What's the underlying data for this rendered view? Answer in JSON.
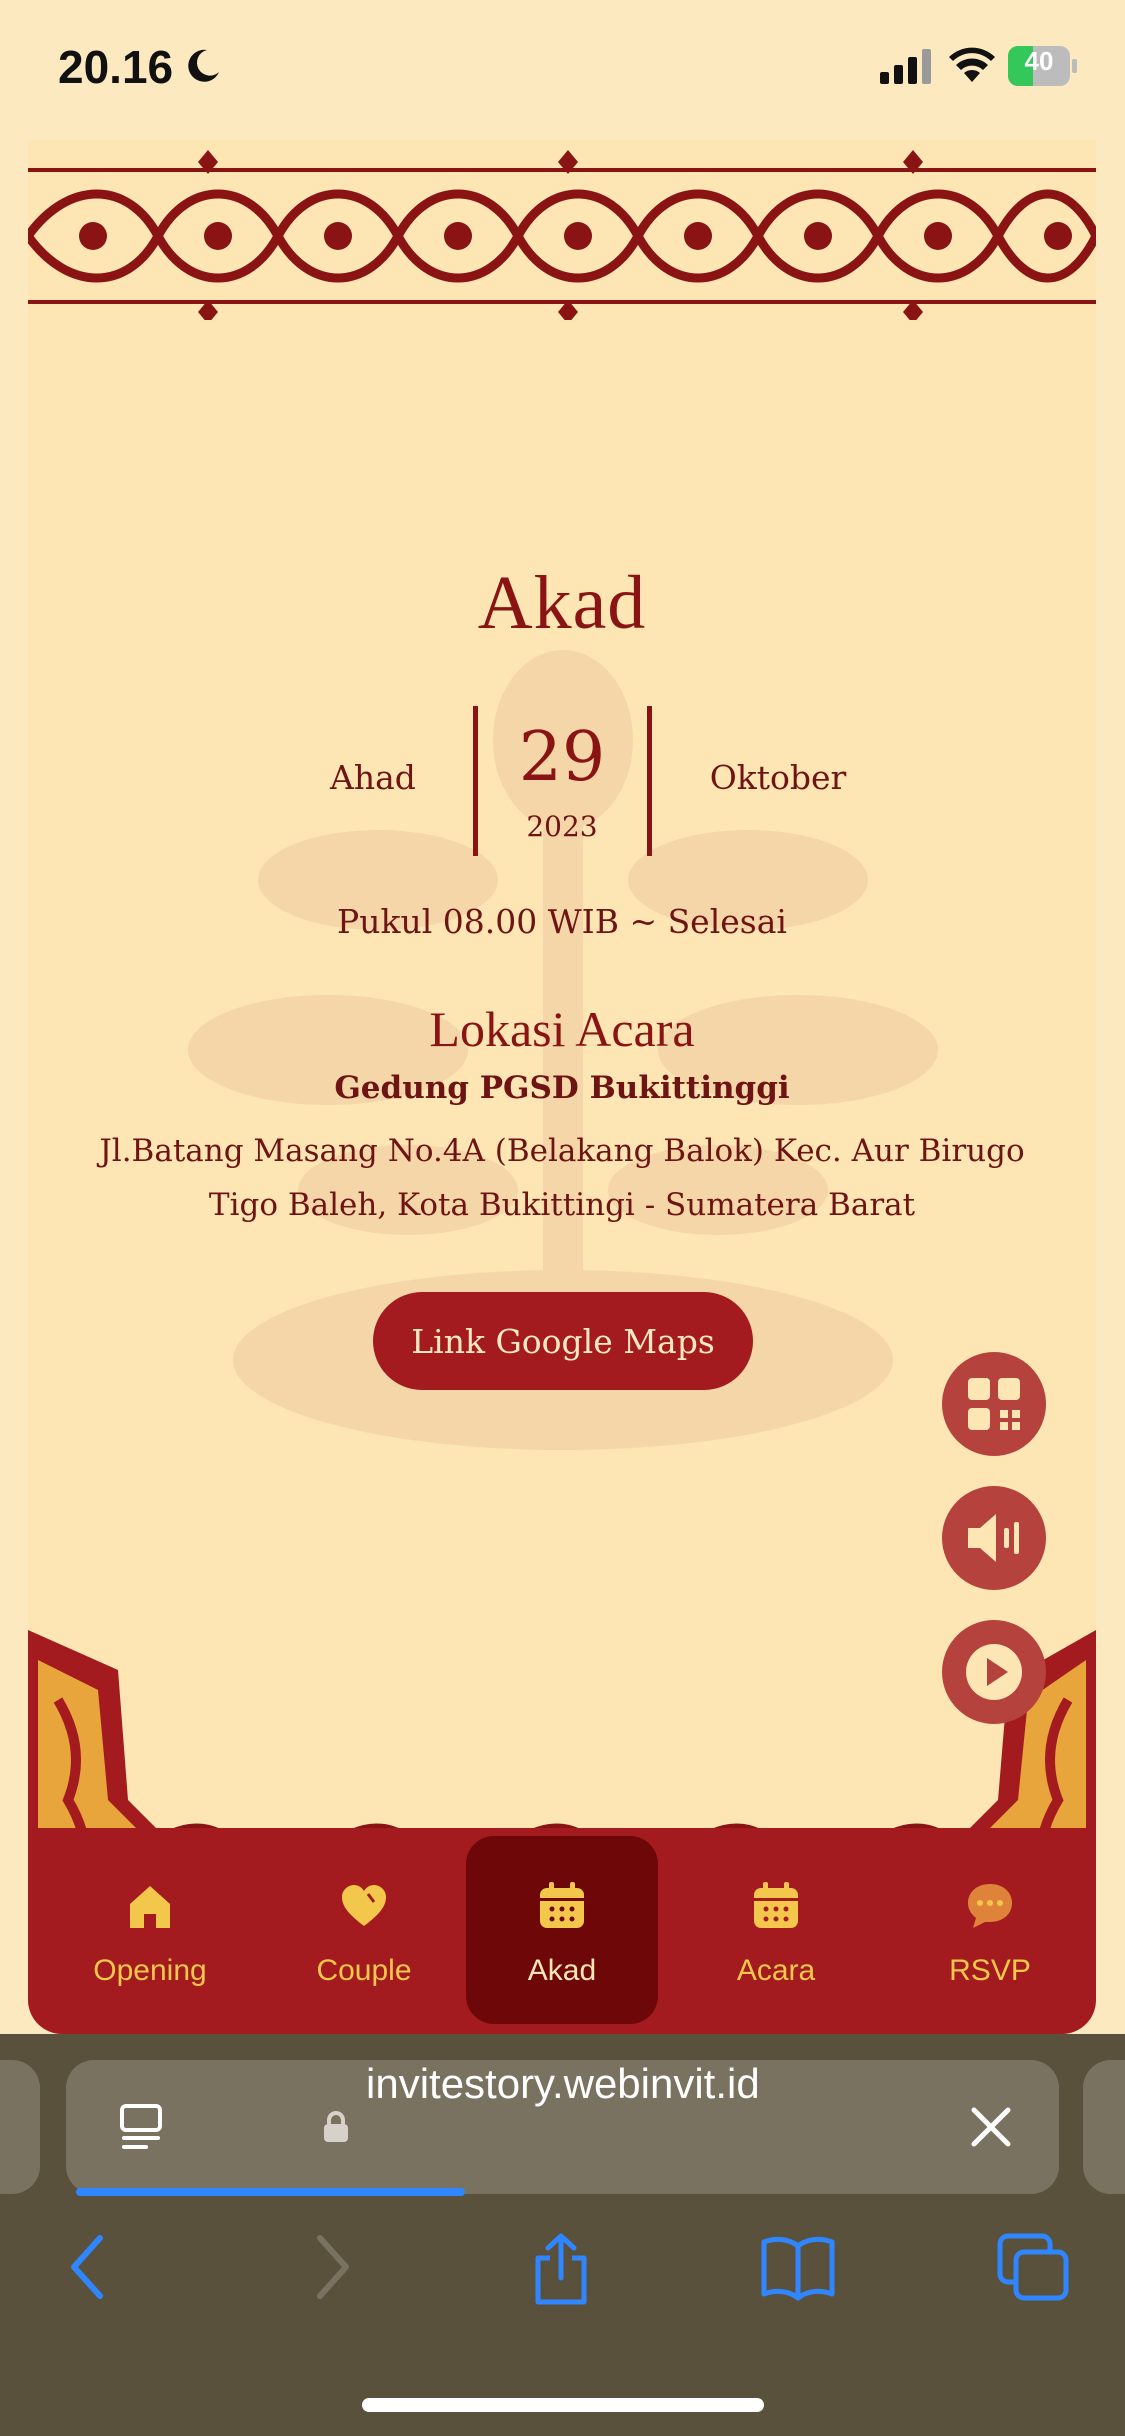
{
  "status_bar": {
    "time": "20.16",
    "battery": "40",
    "battery_level": 0.4,
    "icons": [
      "moon-icon",
      "signal-icon",
      "wifi-icon",
      "battery-icon"
    ]
  },
  "main": {
    "title": "Akad",
    "day": "Ahad",
    "date": "29",
    "year": "2023",
    "month": "Oktober",
    "time_text": "Pukul 08.00 WIB ~ Selesai",
    "location_title": "Lokasi Acara",
    "venue": "Gedung PGSD Bukittinggi",
    "address": "Jl.Batang Masang No.4A (Belakang Balok) Kec. Aur Birugo Tigo Baleh, Kota Bukittingi - Sumatera Barat",
    "maps_button": "Link Google Maps"
  },
  "floating_buttons": [
    "qr-code-icon",
    "speaker-icon",
    "play-icon"
  ],
  "nav": {
    "items": [
      {
        "label": "Opening",
        "icon": "home-icon"
      },
      {
        "label": "Couple",
        "icon": "heart-icon"
      },
      {
        "label": "Akad",
        "icon": "calendar-icon"
      },
      {
        "label": "Acara",
        "icon": "calendar-icon"
      },
      {
        "label": "RSVP",
        "icon": "chat-icon"
      }
    ],
    "active": "Akad"
  },
  "browser": {
    "url": "invitestory.webinvit.id",
    "load_progress": 0.37
  },
  "colors": {
    "background": "#fde5b4",
    "primary": "#a31b1f",
    "active_nav": "#6e0708",
    "nav_text": "#f3c64c",
    "text": "#6f1414",
    "browser_chrome": "#5a513d",
    "link_blue": "#2f86ff"
  }
}
